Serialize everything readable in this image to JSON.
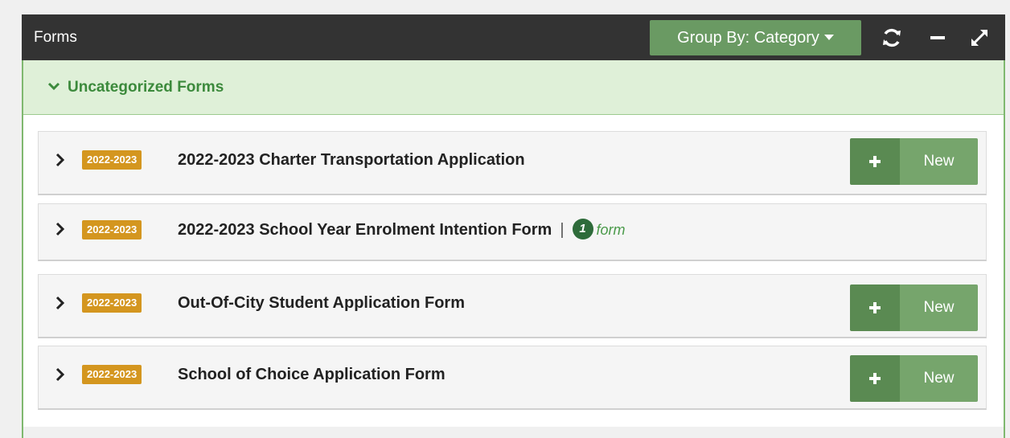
{
  "panel": {
    "title": "Forms",
    "group_by_label": "Group By: Category"
  },
  "header_icons": [
    "refresh-icon",
    "minimize-icon",
    "expand-icon"
  ],
  "category": {
    "label": "Uncategorized Forms"
  },
  "forms": [
    {
      "year": "2022-2023",
      "title": "2022-2023 Charter Transportation Application",
      "new_label": "New"
    },
    {
      "year": "2022-2023",
      "title": "2022-2023 School Year Enrolment Intention Form",
      "separator": "|",
      "count": "1",
      "count_label": "form"
    },
    {
      "year": "2022-2023",
      "title": "Out-Of-City Student Application Form",
      "new_label": "New"
    },
    {
      "year": "2022-2023",
      "title": "School of Choice Application Form",
      "new_label": "New"
    }
  ],
  "colors": {
    "header_bg": "#333333",
    "group_button": "#6a9a63",
    "category_bg": "#dff0d8",
    "category_text": "#3c8a3c",
    "year_badge": "#d4961f",
    "count_badge": "#2e6b3a",
    "new_button_dark": "#5a8a52",
    "new_button_light": "#76a56c"
  }
}
